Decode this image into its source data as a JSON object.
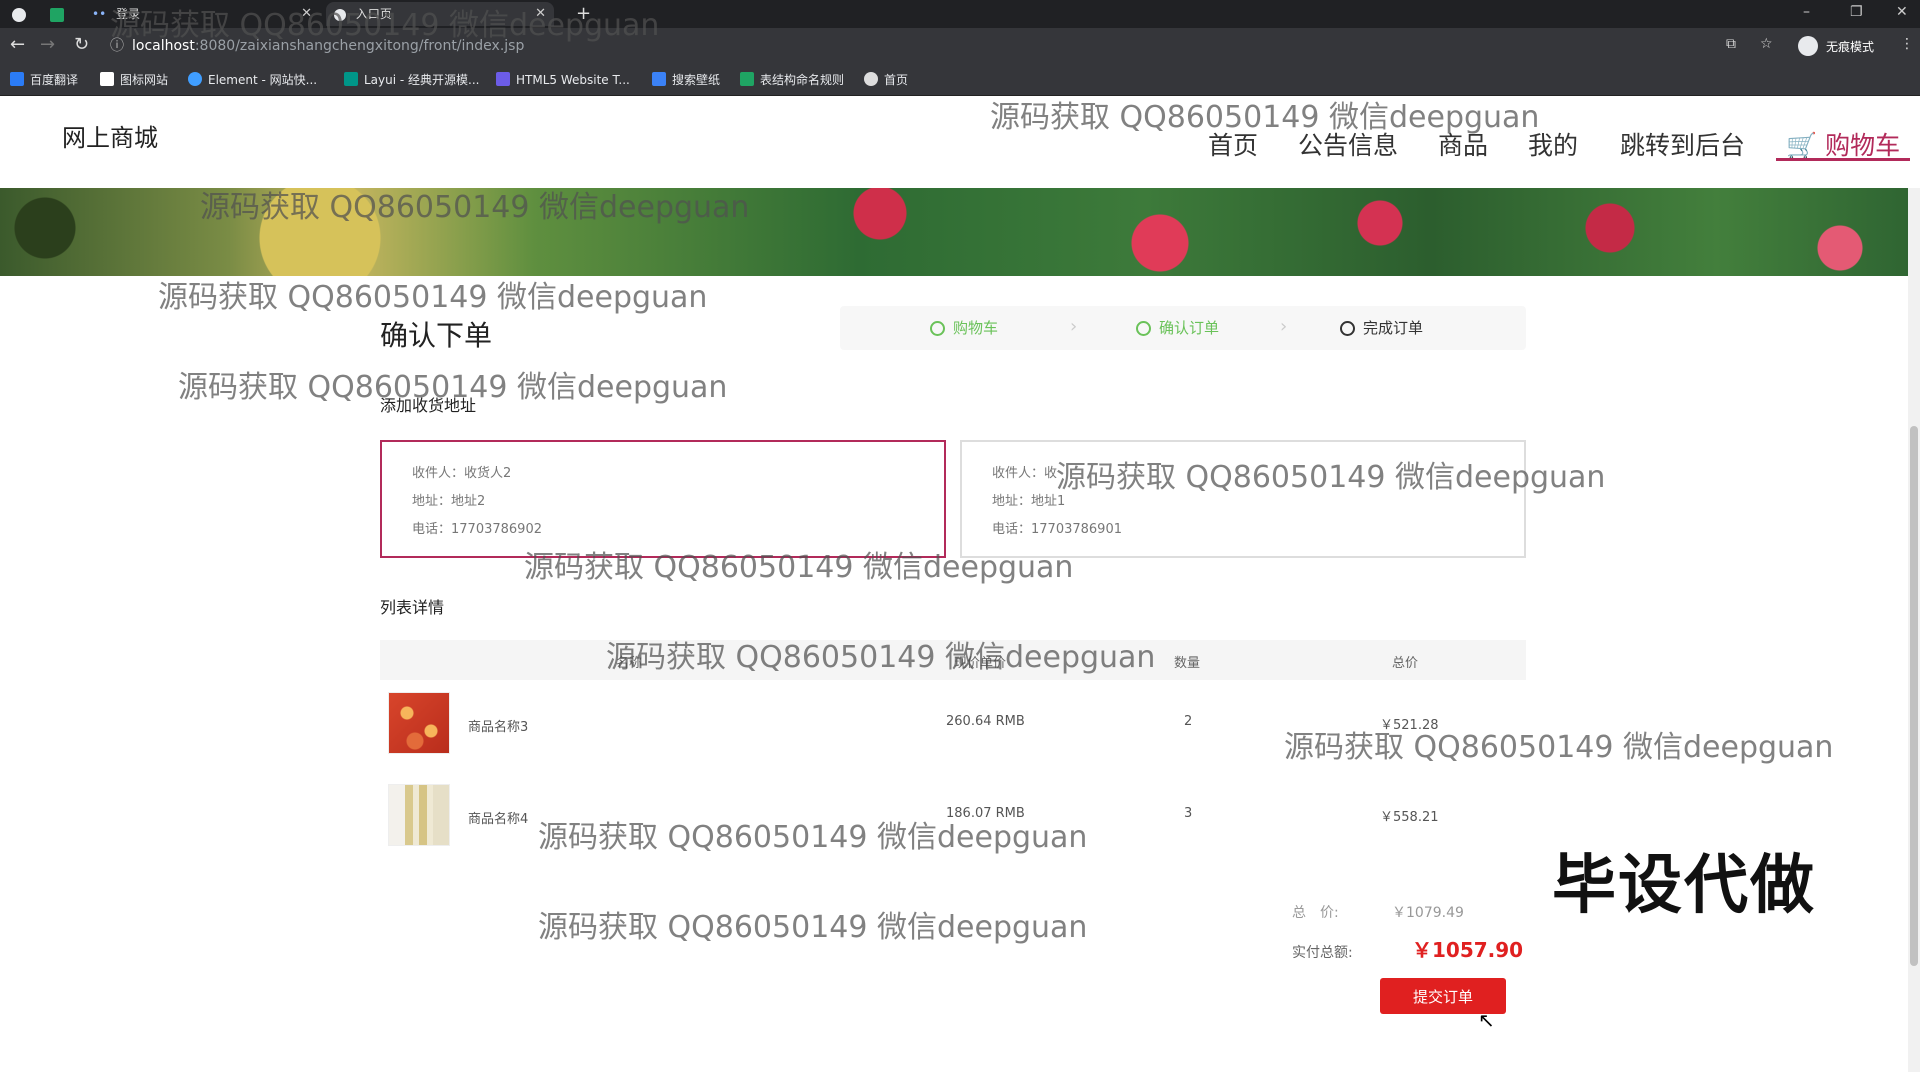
{
  "browser": {
    "tabs": [
      {
        "label": ""
      },
      {
        "label": "登录"
      },
      {
        "label": "入口页"
      }
    ],
    "url_host": "localhost",
    "url_path": ":8080/zaixianshangchengxitong/front/index.jsp",
    "incognito_label": "无痕模式",
    "bookmarks": [
      {
        "label": "百度翻译",
        "color": "#2b7cf6"
      },
      {
        "label": "图标网站",
        "color": "#ffffff"
      },
      {
        "label": "Element - 网站快...",
        "color": "#409eff"
      },
      {
        "label": "Layui - 经典开源模...",
        "color": "#009688"
      },
      {
        "label": "HTML5 Website T...",
        "color": "#6c5ce7"
      },
      {
        "label": "搜索壁纸",
        "color": "#3b82f6"
      },
      {
        "label": "表结构命名规则",
        "color": "#1fa463"
      },
      {
        "label": "首页",
        "color": "#dddddd"
      }
    ]
  },
  "header": {
    "site_title": "网上商城",
    "nav": {
      "home": "首页",
      "notice": "公告信息",
      "goods": "商品",
      "mine": "我的",
      "backend": "跳转到后台",
      "cart": "购物车"
    },
    "accent_color": "#b22a5a"
  },
  "confirm": {
    "title": "确认下单",
    "steps": [
      "购物车",
      "确认订单",
      "完成订单"
    ],
    "address_heading": "添加收货地址",
    "addresses": [
      {
        "receiver": "收件人：收货人2",
        "address": "地址：地址2",
        "phone": "电话：17703786902",
        "selected": true
      },
      {
        "receiver": "收件人：收",
        "address": "地址：地址1",
        "phone": "电话：17703786901",
        "selected": false
      }
    ],
    "list_heading": "列表详情",
    "table_headers": [
      "名称",
      "现价单价",
      "数量",
      "总价"
    ],
    "items": [
      {
        "name": "商品名称3",
        "price": "260.64 RMB",
        "qty": "2",
        "total": "￥521.28",
        "image": "red-flower-food"
      },
      {
        "name": "商品名称4",
        "price": "186.07 RMB",
        "qty": "3",
        "total": "￥558.21",
        "image": "bottles"
      }
    ],
    "sum_label": "总　价:",
    "sum_value": "￥1079.49",
    "pay_label": "实付总额:",
    "pay_value": "￥1057.90",
    "submit_label": "提交订单"
  },
  "overlay": {
    "watermark": "源码获取 QQ86050149 微信deepguan",
    "promo": "毕设代做"
  }
}
